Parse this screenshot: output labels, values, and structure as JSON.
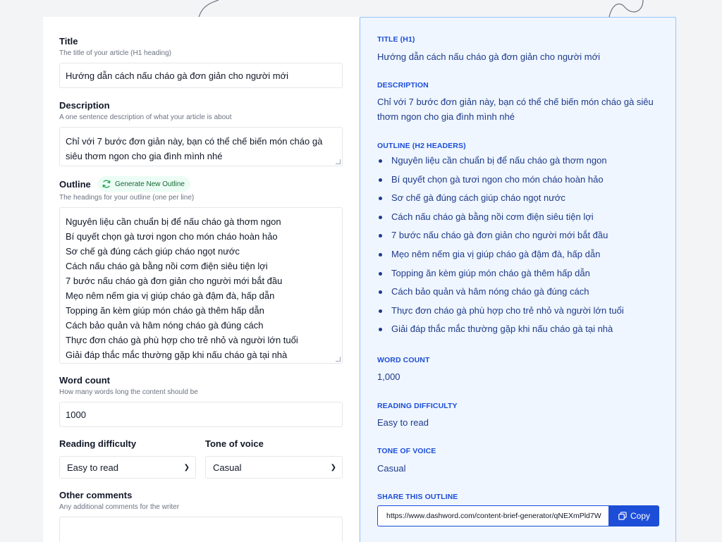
{
  "form": {
    "title_label": "Title",
    "title_hint": "The title of your article (H1 heading)",
    "title_value": "Hướng dẫn cách nấu cháo gà đơn giản cho người mới",
    "description_label": "Description",
    "description_hint": "A one sentence description of what your article is about",
    "description_value": "Chỉ với 7 bước đơn giản này, bạn có thể chế biến món cháo gà siêu thơm ngon cho gia đình mình nhé",
    "outline_label": "Outline",
    "generate_label": "Generate New Outline",
    "outline_hint": "The headings for your outline (one per line)",
    "outline_value": "Nguyên liệu cần chuẩn bị để nấu cháo gà thơm ngon\nBí quyết chọn gà tươi ngon cho món cháo hoàn hảo\nSơ chế gà đúng cách giúp cháo ngọt nước\nCách nấu cháo gà bằng nồi cơm điện siêu tiện lợi\n7 bước nấu cháo gà đơn giản cho người mới bắt đầu\nMẹo nêm nếm gia vị giúp cháo gà đậm đà, hấp dẫn\nTopping ăn kèm giúp món cháo gà thêm hấp dẫn\nCách bảo quản và hâm nóng cháo gà đúng cách\nThực đơn cháo gà phù hợp cho trẻ nhỏ và người lớn tuổi\nGiải đáp thắc mắc thường gặp khi nấu cháo gà tại nhà",
    "word_count_label": "Word count",
    "word_count_hint": "How many words long the content should be",
    "word_count_value": "1000",
    "difficulty_label": "Reading difficulty",
    "difficulty_value": "Easy to read",
    "tone_label": "Tone of voice",
    "tone_value": "Casual",
    "comments_label": "Other comments",
    "comments_hint": "Any additional comments for the writer"
  },
  "preview": {
    "title_heading": "TITLE (H1)",
    "title_value": "Hướng dẫn cách nấu cháo gà đơn giản cho người mới",
    "description_heading": "DESCRIPTION",
    "description_value": "Chỉ với 7 bước đơn giản này, bạn có thể chế biến món cháo gà siêu thơm ngon cho gia đình mình nhé",
    "outline_heading": "OUTLINE (H2 HEADERS)",
    "outline_items": [
      "Nguyên liệu cần chuẩn bị để nấu cháo gà thơm ngon",
      "Bí quyết chọn gà tươi ngon cho món cháo hoàn hảo",
      "Sơ chế gà đúng cách giúp cháo ngọt nước",
      "Cách nấu cháo gà bằng nồi cơm điện siêu tiện lợi",
      "7 bước nấu cháo gà đơn giản cho người mới bắt đầu",
      "Mẹo nêm nếm gia vị giúp cháo gà đậm đà, hấp dẫn",
      "Topping ăn kèm giúp món cháo gà thêm hấp dẫn",
      "Cách bảo quản và hâm nóng cháo gà đúng cách",
      "Thực đơn cháo gà phù hợp cho trẻ nhỏ và người lớn tuổi",
      "Giải đáp thắc mắc thường gặp khi nấu cháo gà tại nhà"
    ],
    "word_count_heading": "WORD COUNT",
    "word_count_value": "1,000",
    "difficulty_heading": "READING DIFFICULTY",
    "difficulty_value": "Easy to read",
    "tone_heading": "TONE OF VOICE",
    "tone_value": "Casual",
    "share_heading": "SHARE THIS OUTLINE",
    "share_url": "https://www.dashword.com/content-brief-generator/qNEXmPld7W",
    "copy_label": "Copy"
  },
  "icons": {
    "refresh": "refresh-icon",
    "copy": "copy-icon",
    "chevron": "chevron-down-icon",
    "arrow": "curved-arrow-icon"
  },
  "colors": {
    "accent": "#1d4ed8",
    "preview_bg": "#eff6ff",
    "preview_text": "#1e3a8a",
    "generate_bg": "#ecfdf5",
    "generate_text": "#166534"
  }
}
